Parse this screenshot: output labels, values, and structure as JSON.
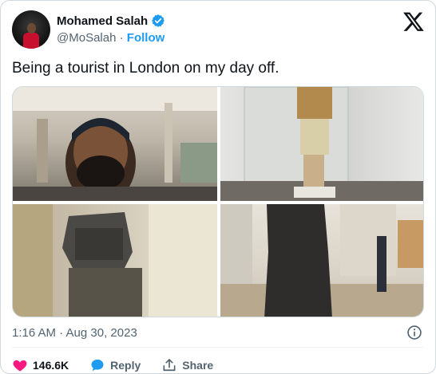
{
  "user": {
    "name": "Mohamed Salah",
    "handle": "@MoSalah",
    "separator": "·",
    "follow_label": "Follow"
  },
  "tweet": {
    "text": "Being a tourist in London on my day off.",
    "timestamp": "1:16 AM · Aug 30, 2023"
  },
  "actions": {
    "likes": "146.6K",
    "reply_label": "Reply",
    "share_label": "Share"
  },
  "colors": {
    "verified": "#1d9bf0",
    "follow": "#1d9bf0",
    "like": "#f91880",
    "reply": "#1d9bf0",
    "secondary_text": "#536471"
  },
  "icons": [
    "verified-badge-icon",
    "x-logo-icon",
    "info-icon",
    "heart-icon",
    "reply-bubble-icon",
    "share-icon"
  ]
}
